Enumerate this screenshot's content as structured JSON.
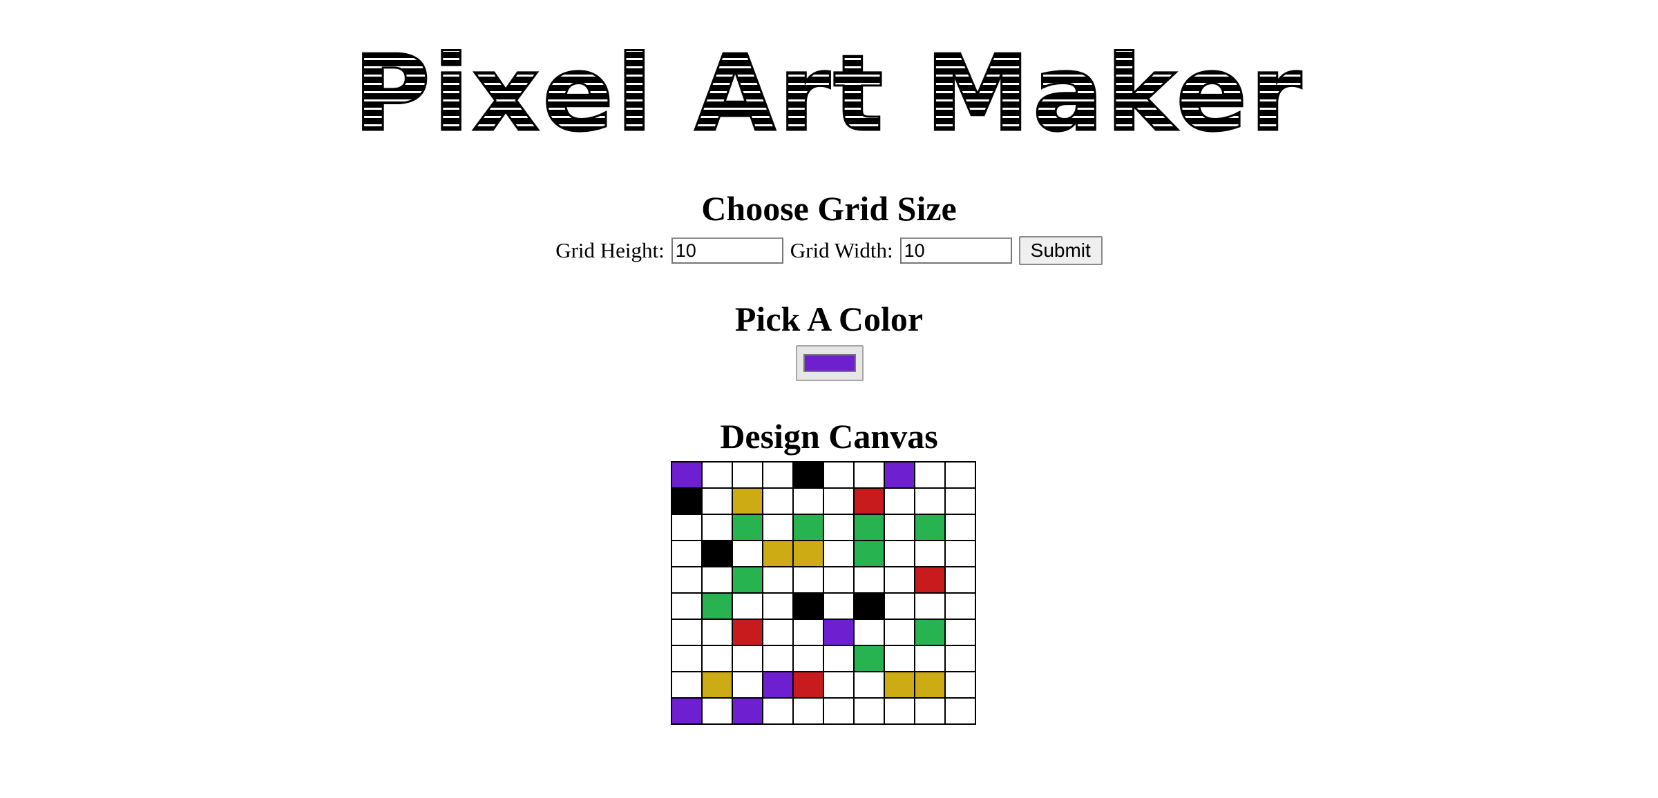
{
  "title": "Pixel Art Maker",
  "grid_size": {
    "heading": "Choose Grid Size",
    "height_label": "Grid Height:",
    "height_value": "10",
    "width_label": "Grid Width:",
    "width_value": "10",
    "submit_label": "Submit"
  },
  "color": {
    "heading": "Pick A Color",
    "selected": "#6e1fcf"
  },
  "canvas": {
    "heading": "Design Canvas",
    "palette": {
      "W": "#ffffff",
      "P": "#6e1fcf",
      "K": "#000000",
      "Y": "#ccab15",
      "R": "#c81b1e",
      "G": "#27b34f"
    },
    "rows": [
      [
        "P",
        "W",
        "W",
        "W",
        "K",
        "W",
        "W",
        "P",
        "W",
        "W"
      ],
      [
        "K",
        "W",
        "Y",
        "W",
        "W",
        "W",
        "R",
        "W",
        "W",
        "W"
      ],
      [
        "W",
        "W",
        "G",
        "W",
        "G",
        "W",
        "G",
        "W",
        "G",
        "W"
      ],
      [
        "W",
        "K",
        "W",
        "Y",
        "Y",
        "W",
        "G",
        "W",
        "W",
        "W"
      ],
      [
        "W",
        "W",
        "G",
        "W",
        "W",
        "W",
        "W",
        "W",
        "R",
        "W"
      ],
      [
        "W",
        "G",
        "W",
        "W",
        "K",
        "W",
        "K",
        "W",
        "W",
        "W"
      ],
      [
        "W",
        "W",
        "R",
        "W",
        "W",
        "P",
        "W",
        "W",
        "G",
        "W"
      ],
      [
        "W",
        "W",
        "W",
        "W",
        "W",
        "W",
        "G",
        "W",
        "W",
        "W"
      ],
      [
        "W",
        "Y",
        "W",
        "P",
        "R",
        "W",
        "W",
        "Y",
        "Y",
        "W"
      ],
      [
        "P",
        "W",
        "P",
        "W",
        "W",
        "W",
        "W",
        "W",
        "W",
        "W"
      ]
    ]
  }
}
